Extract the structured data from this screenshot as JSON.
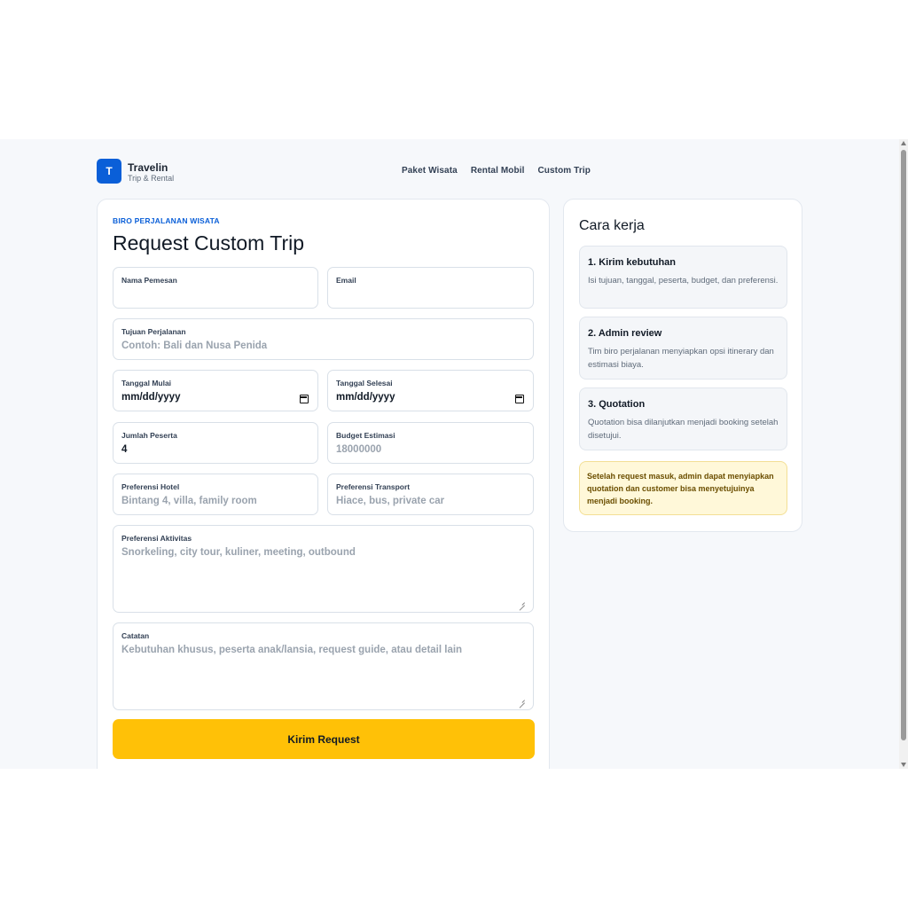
{
  "brand": {
    "logo_letter": "T",
    "name": "Travelin",
    "tagline": "Trip & Rental"
  },
  "nav": {
    "items": [
      "Paket Wisata",
      "Rental Mobil",
      "Custom Trip"
    ]
  },
  "form": {
    "eyebrow": "BIRO PERJALANAN WISATA",
    "title": "Request Custom Trip",
    "fields": {
      "nama": {
        "label": "Nama Pemesan",
        "value": ""
      },
      "email": {
        "label": "Email",
        "value": ""
      },
      "tujuan": {
        "label": "Tujuan Perjalanan",
        "placeholder": "Contoh: Bali dan Nusa Penida"
      },
      "mulai": {
        "label": "Tanggal Mulai",
        "value": "mm/dd/yyyy"
      },
      "selesai": {
        "label": "Tanggal Selesai",
        "value": "mm/dd/yyyy"
      },
      "peserta": {
        "label": "Jumlah Peserta",
        "value": "4"
      },
      "budget": {
        "label": "Budget Estimasi",
        "placeholder": "18000000"
      },
      "hotel": {
        "label": "Preferensi Hotel",
        "placeholder": "Bintang 4, villa, family room"
      },
      "transport": {
        "label": "Preferensi Transport",
        "placeholder": "Hiace, bus, private car"
      },
      "aktivitas": {
        "label": "Preferensi Aktivitas",
        "placeholder": "Snorkeling, city tour, kuliner, meeting, outbound"
      },
      "catatan": {
        "label": "Catatan",
        "placeholder": "Kebutuhan khusus, peserta anak/lansia, request guide, atau detail lain"
      }
    },
    "submit_label": "Kirim Request"
  },
  "sidebar": {
    "title": "Cara kerja",
    "steps": [
      {
        "title": "1. Kirim kebutuhan",
        "desc": "Isi tujuan, tanggal, peserta, budget, dan preferensi."
      },
      {
        "title": "2. Admin review",
        "desc": "Tim biro perjalanan menyiapkan opsi itinerary dan estimasi biaya."
      },
      {
        "title": "3. Quotation",
        "desc": "Quotation bisa dilanjutkan menjadi booking setelah disetujui."
      }
    ],
    "notice": "Setelah request masuk, admin dapat menyiapkan quotation dan customer bisa menyetujuinya menjadi booking."
  },
  "colors": {
    "primary": "#0a5fd8",
    "accent": "#ffc107",
    "notice_bg": "#fff8d9"
  }
}
